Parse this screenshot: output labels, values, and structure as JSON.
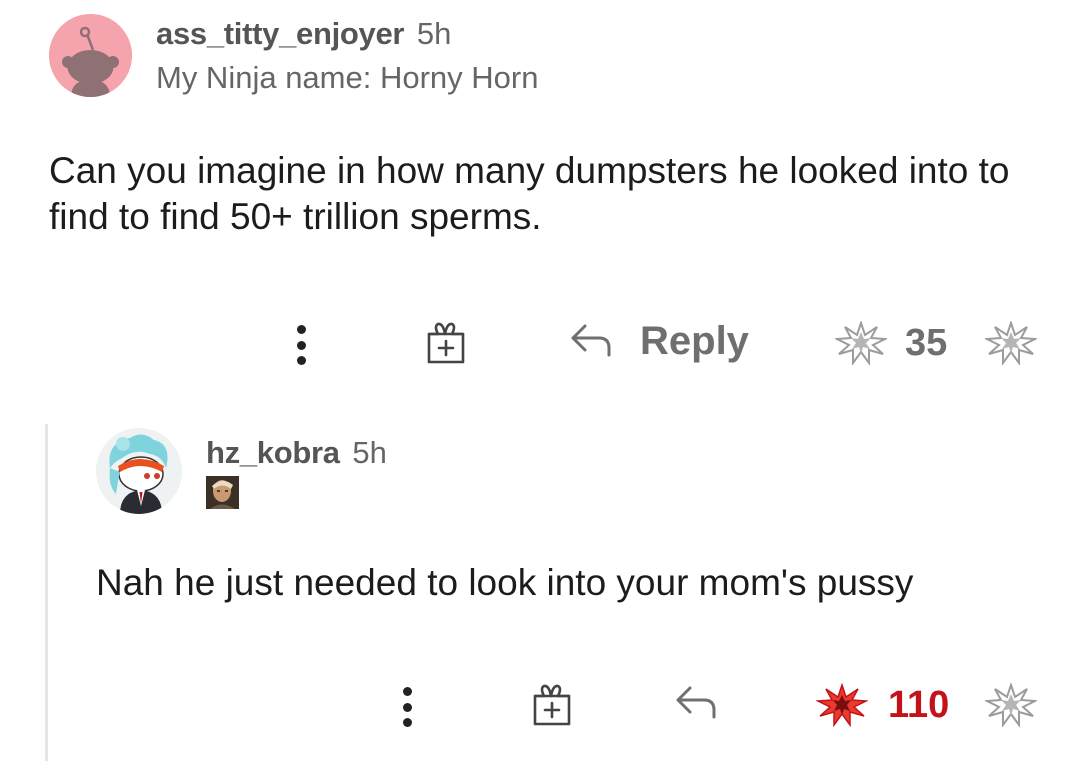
{
  "comment": {
    "username": "ass_titty_enjoyer",
    "time": "5h",
    "flair": "My Ninja name: Horny Horn",
    "body": "Can you imagine in how many dumpsters he looked into to find to find 50+ trillion sperms.",
    "actions": {
      "reply_label": "Reply",
      "vote_count": "35"
    }
  },
  "reply": {
    "username": "hz_kobra",
    "time": "5h",
    "body": "Nah he just needed to look into your mom's pussy",
    "actions": {
      "vote_count": "110"
    }
  },
  "colors": {
    "avatar_pink": "#f5a3ad",
    "upvoted_red": "#c4121b",
    "muted_gray": "#6f6f6f"
  },
  "icons": {
    "more": "kebab-menu-icon",
    "award": "gift-box-icon",
    "reply": "reply-arrow-icon",
    "upvote": "starburst-upvote-icon",
    "downvote": "starburst-downvote-icon"
  }
}
